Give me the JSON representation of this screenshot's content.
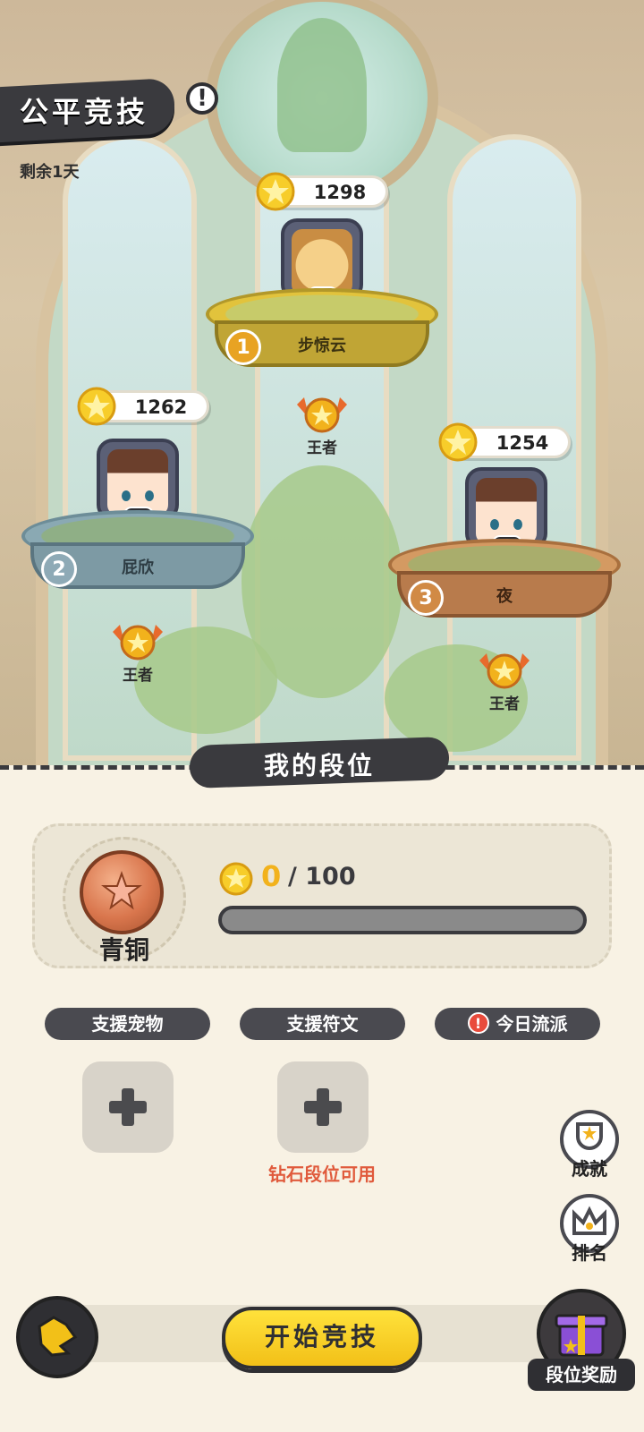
{
  "header": {
    "title": "公平竞技",
    "remaining": "剩余1天",
    "info_icon": "exclamation-icon"
  },
  "leaderboard": [
    {
      "rank": "1",
      "name": "步惊云",
      "score": "1298",
      "tier": "王者",
      "badge": "0"
    },
    {
      "rank": "2",
      "name": "屁欣",
      "score": "1262",
      "tier": "王者",
      "badge": "0"
    },
    {
      "rank": "3",
      "name": "夜",
      "score": "1254",
      "tier": "王者",
      "badge": "0"
    }
  ],
  "my_rank": {
    "section_title": "我的段位",
    "tier_name": "青铜",
    "current_points": "0",
    "total_points": "/ 100",
    "progress_fraction": 0
  },
  "support": {
    "pet_label": "支援宠物",
    "rune_label": "支援符文",
    "daily_label": "今日流派",
    "daily_warn": "!",
    "rune_note": "钻石段位可用"
  },
  "side": {
    "achievements_label": "成就",
    "ranking_label": "排名"
  },
  "bottom": {
    "start_label": "开始竞技",
    "reward_label": "段位奖励"
  },
  "colors": {
    "accent_yellow": "#f2b21c",
    "dark": "#3a3a3e",
    "warning_red": "#e05a3c"
  }
}
